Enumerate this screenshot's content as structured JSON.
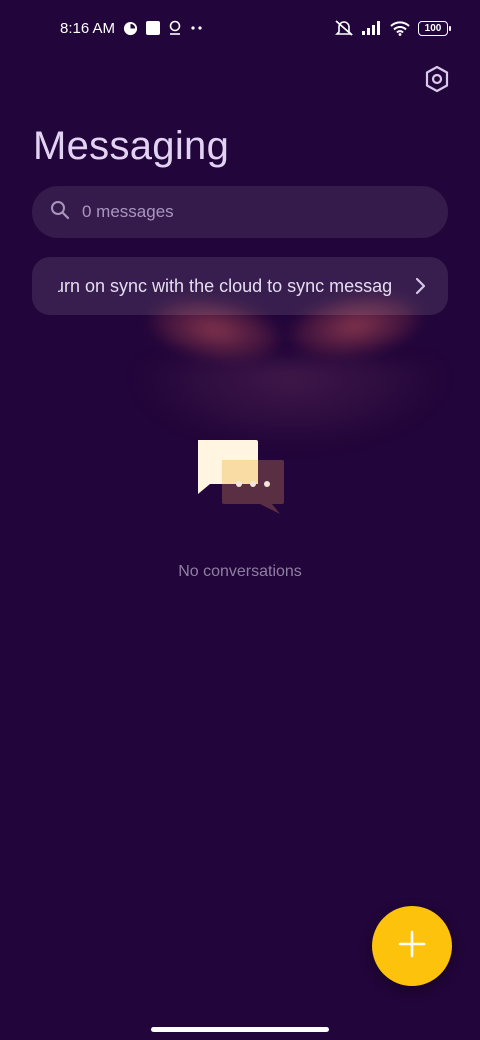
{
  "status_bar": {
    "time": "8:16 AM",
    "battery": "100",
    "left_icons": [
      "notification-app-icon",
      "square-icon",
      "location-pin-icon",
      "more-dots-icon"
    ],
    "right_icons": [
      "mute-vibrate-icon",
      "signal-icon",
      "wifi-icon",
      "battery-icon"
    ]
  },
  "header": {
    "title": "Messaging",
    "settings_icon": "settings-hex-icon"
  },
  "search": {
    "placeholder": "0 messages",
    "icon": "search-icon"
  },
  "sync_banner": {
    "text": "urn on sync with the cloud to sync messag",
    "icon": "chevron-right-icon"
  },
  "empty_state": {
    "icon": "chat-bubbles-icon",
    "text": "No conversations"
  },
  "fab": {
    "icon": "plus-icon",
    "color": "#fdc20c"
  },
  "colors": {
    "background": "#22053a",
    "accent": "#fdc20c"
  }
}
